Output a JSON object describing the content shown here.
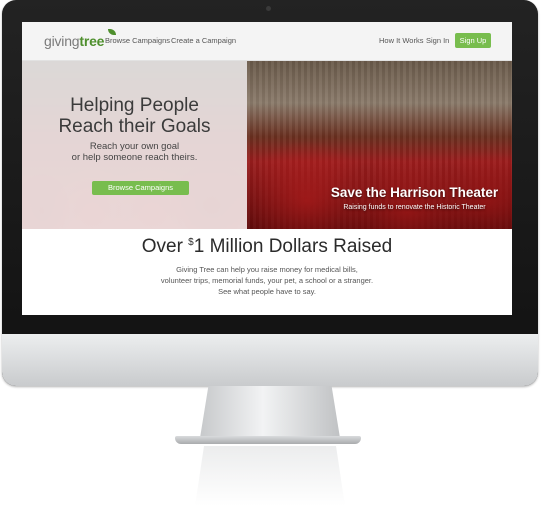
{
  "brand": {
    "logo_part1": "giving",
    "logo_part2": "tree"
  },
  "nav": {
    "browse": "Browse Campaigns",
    "create": "Create a Campaign",
    "how": "How It Works",
    "signin": "Sign In",
    "signup": "Sign Up"
  },
  "hero": {
    "title_line1": "Helping People",
    "title_line2": "Reach their Goals",
    "sub_line1": "Reach your own goal",
    "sub_line2": "or help someone reach theirs.",
    "button": "Browse Campaigns",
    "campaign_title": "Save the Harrison Theater",
    "campaign_desc": "Raising funds to renovate the Historic Theater"
  },
  "stats": {
    "title_prefix": "Over ",
    "currency": "$",
    "title_suffix": "1 Million Dollars Raised",
    "line1": "Giving Tree can help you raise money for medical bills,",
    "line2": "volunteer trips, memorial funds, your pet, a school or a stranger.",
    "line3": "See what people have to say."
  },
  "colors": {
    "accent_green": "#78bd4e",
    "logo_green": "#4e8f2d"
  }
}
